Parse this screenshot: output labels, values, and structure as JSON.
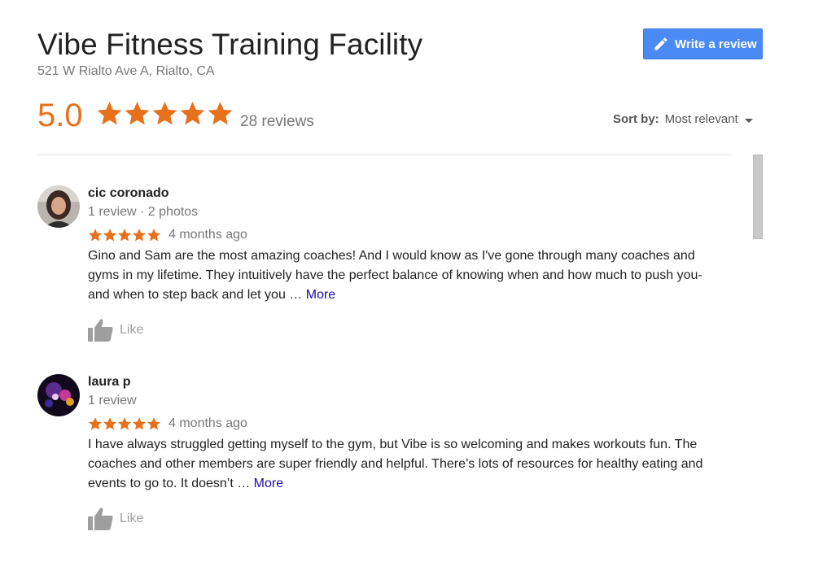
{
  "business": {
    "name": "Vibe Fitness Training Facility",
    "address": "521 W Rialto Ave A, Rialto, CA"
  },
  "write_review": {
    "label": "Write a review",
    "icon": "pencil-icon"
  },
  "summary": {
    "rating": "5.0",
    "stars": 5,
    "review_count": "28 reviews"
  },
  "sort": {
    "label": "Sort by:",
    "value": "Most relevant"
  },
  "colors": {
    "star": "#e7711b",
    "button": "#4a8af4",
    "link": "#1a0dab"
  },
  "reviews": [
    {
      "author": "cic coronado",
      "meta": "1 review · 2 photos",
      "stars": 5,
      "time": "4 months ago",
      "text": "Gino and Sam are the most amazing coaches! And I would know as I've gone through many coaches and gyms in my lifetime.  They intuitively have the perfect balance of knowing when and how much to push you-and when to step back and let you … ",
      "more": "More",
      "like": "Like"
    },
    {
      "author": "laura p",
      "meta": "1 review",
      "stars": 5,
      "time": "4 months ago",
      "text": "I have always struggled getting myself to the gym, but Vibe is so welcoming and makes workouts fun. The coaches and other members are super friendly and helpful. There’s lots of resources for healthy eating and events to go to. It doesn’t … ",
      "more": "More",
      "like": "Like"
    }
  ]
}
